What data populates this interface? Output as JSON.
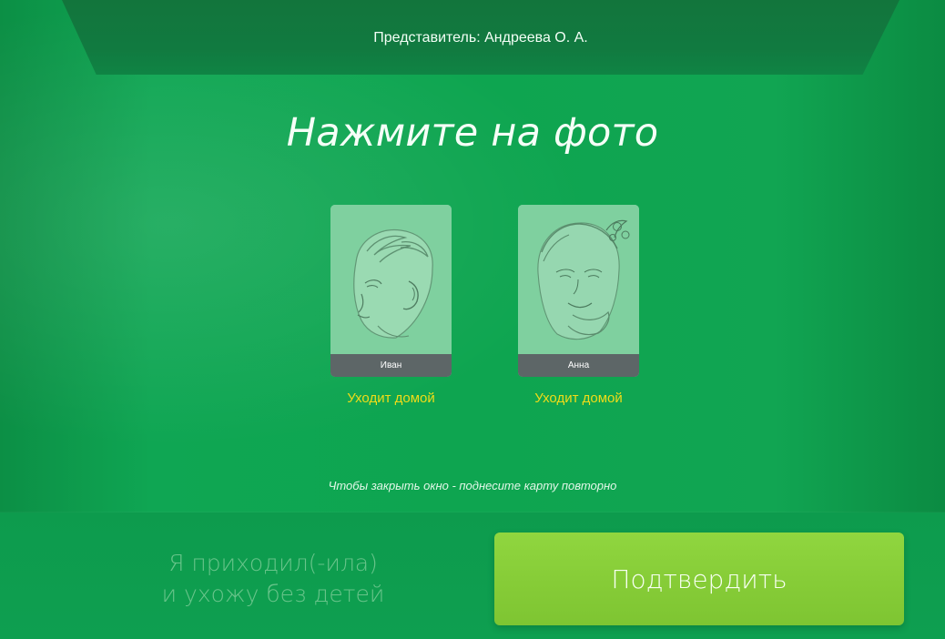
{
  "header": {
    "representative_label": "Представитель: Андреева О. А."
  },
  "main": {
    "title": "Нажмите на фото",
    "children": [
      {
        "name": "Иван",
        "status": "Уходит домой",
        "photo_icon": "boy-portrait-sketch"
      },
      {
        "name": "Анна",
        "status": "Уходит домой",
        "photo_icon": "girl-portrait-sketch"
      }
    ],
    "hint": "Чтобы закрыть окно - поднесите карту повторно"
  },
  "actions": {
    "left_line_1": "Я приходил(-ила)",
    "left_line_2": "и ухожу без детей",
    "confirm": "Подтвердить"
  },
  "colors": {
    "background": "#0fa653",
    "header": "#11783f",
    "status": "#f0dc18",
    "confirm_button": "#86cc37",
    "name_bar": "#5d6667"
  }
}
